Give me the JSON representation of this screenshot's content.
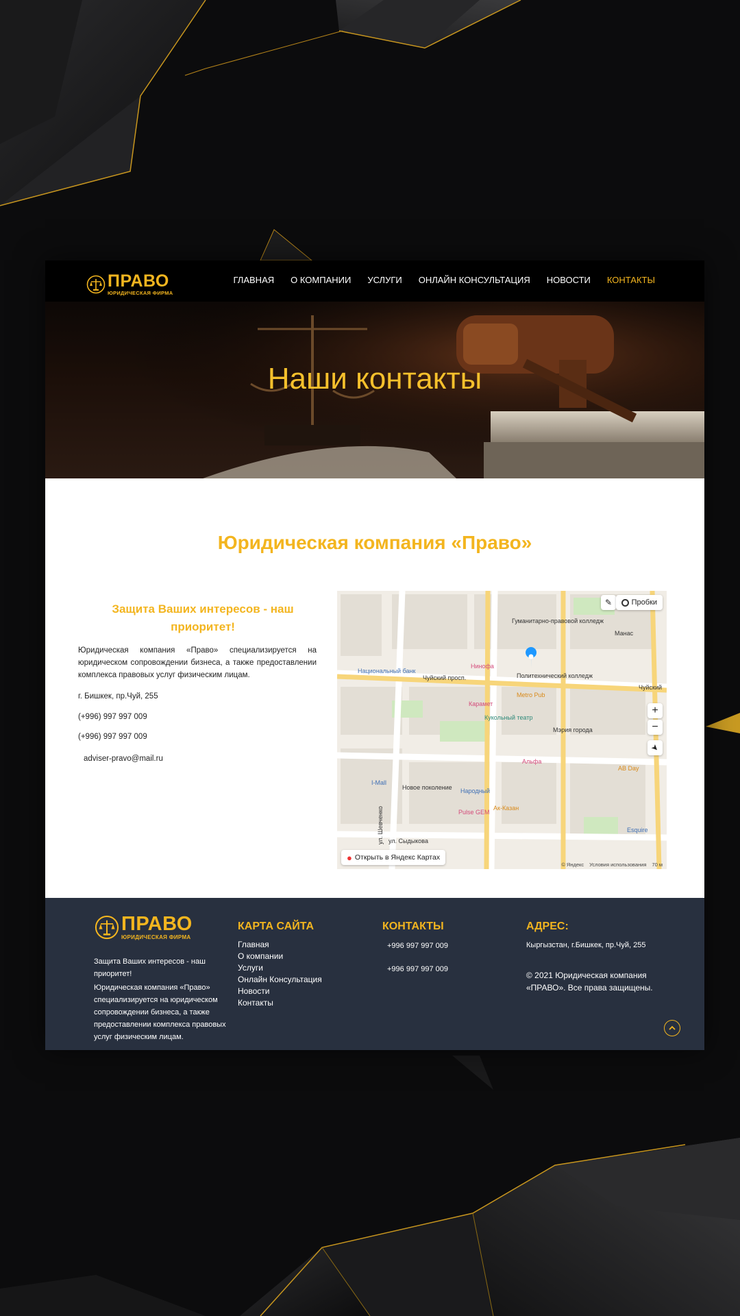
{
  "brand": {
    "name": "ПРАВО",
    "tagline": "ЮРИДИЧЕСКАЯ ФИРМА",
    "accent_color": "#f3b51f",
    "footer_color": "#28303f"
  },
  "nav": {
    "items": [
      {
        "label": "ГЛАВНАЯ"
      },
      {
        "label": "О КОМПАНИИ"
      },
      {
        "label": "УСЛУГИ"
      },
      {
        "label": "ОНЛАЙН КОНСУЛЬТАЦИЯ"
      },
      {
        "label": "НОВОСТИ"
      },
      {
        "label": "КОНТАКТЫ",
        "active": true
      }
    ]
  },
  "hero": {
    "title": "Наши контакты"
  },
  "main": {
    "company_title": "Юридическая компания «Право»",
    "slogan": "Защита Ваших интересов - наш приоритет!",
    "description": "Юридическая компания «Право» специализируется на юридическом сопровождении бизнеса, а также предоставлении комплекса правовых услуг физическим лицам.",
    "address": "г. Бишкек, пр.Чуй, 255",
    "phone1": "(+996) 997 997 009",
    "phone2": "(+996) 997 997 009",
    "email": "adviser-pravo@mail.ru"
  },
  "map": {
    "open_label": "Открыть в Яндекс Картах",
    "traffic_label": "Пробки",
    "zoom_in": "+",
    "zoom_out": "−",
    "copyright": "© Яндекс",
    "terms": "Условия использования",
    "scale": "70 м",
    "labels": {
      "street1": "Чуйский просп.",
      "street2": "Чуйский",
      "street3": "ул. Сыдыкова",
      "street4": "ул. Шевченко",
      "poi1": "Гуманитарно-правовой колледж",
      "poi2": "Политехнический колледж",
      "poi3": "Национальный банк",
      "poi4": "Кукольный театр",
      "poi5": "Мэрия города",
      "poi6": "Metro Pub",
      "poi7": "Альфа",
      "poi8": "I-Mall",
      "poi9": "Новое поколение",
      "poi10": "Народный",
      "poi11": "Ак-Казан",
      "poi12": "Pulse GEM",
      "poi13": "AB Day",
      "poi14": "Esquire",
      "poi15": "Манас",
      "poi16": "Карамет",
      "poi17": "Нинофа"
    }
  },
  "footer": {
    "slogan": "Защита Ваших интересов - наш приоритет!",
    "description": "Юридическая компания «Право» специализируется на юридическом сопровождении бизнеса, а также предоставлении комплекса правовых услуг физическим лицам.",
    "sitemap_title": "КАРТА САЙТА",
    "sitemap_links": [
      "Главная",
      "О компании",
      "Услуги",
      "Онлайн Консультация",
      "Новости",
      "Контакты"
    ],
    "contacts_title": "КОНТАКТЫ",
    "phone1": "+996 997 997 009",
    "phone2": "+996 997 997 009",
    "address_title": "АДРЕС:",
    "address": "Кыргызстан, г.Бишкек, пр.Чуй, 255",
    "copyright": "© 2021 Юридическая компания «ПРАВО». Все права защищены."
  }
}
